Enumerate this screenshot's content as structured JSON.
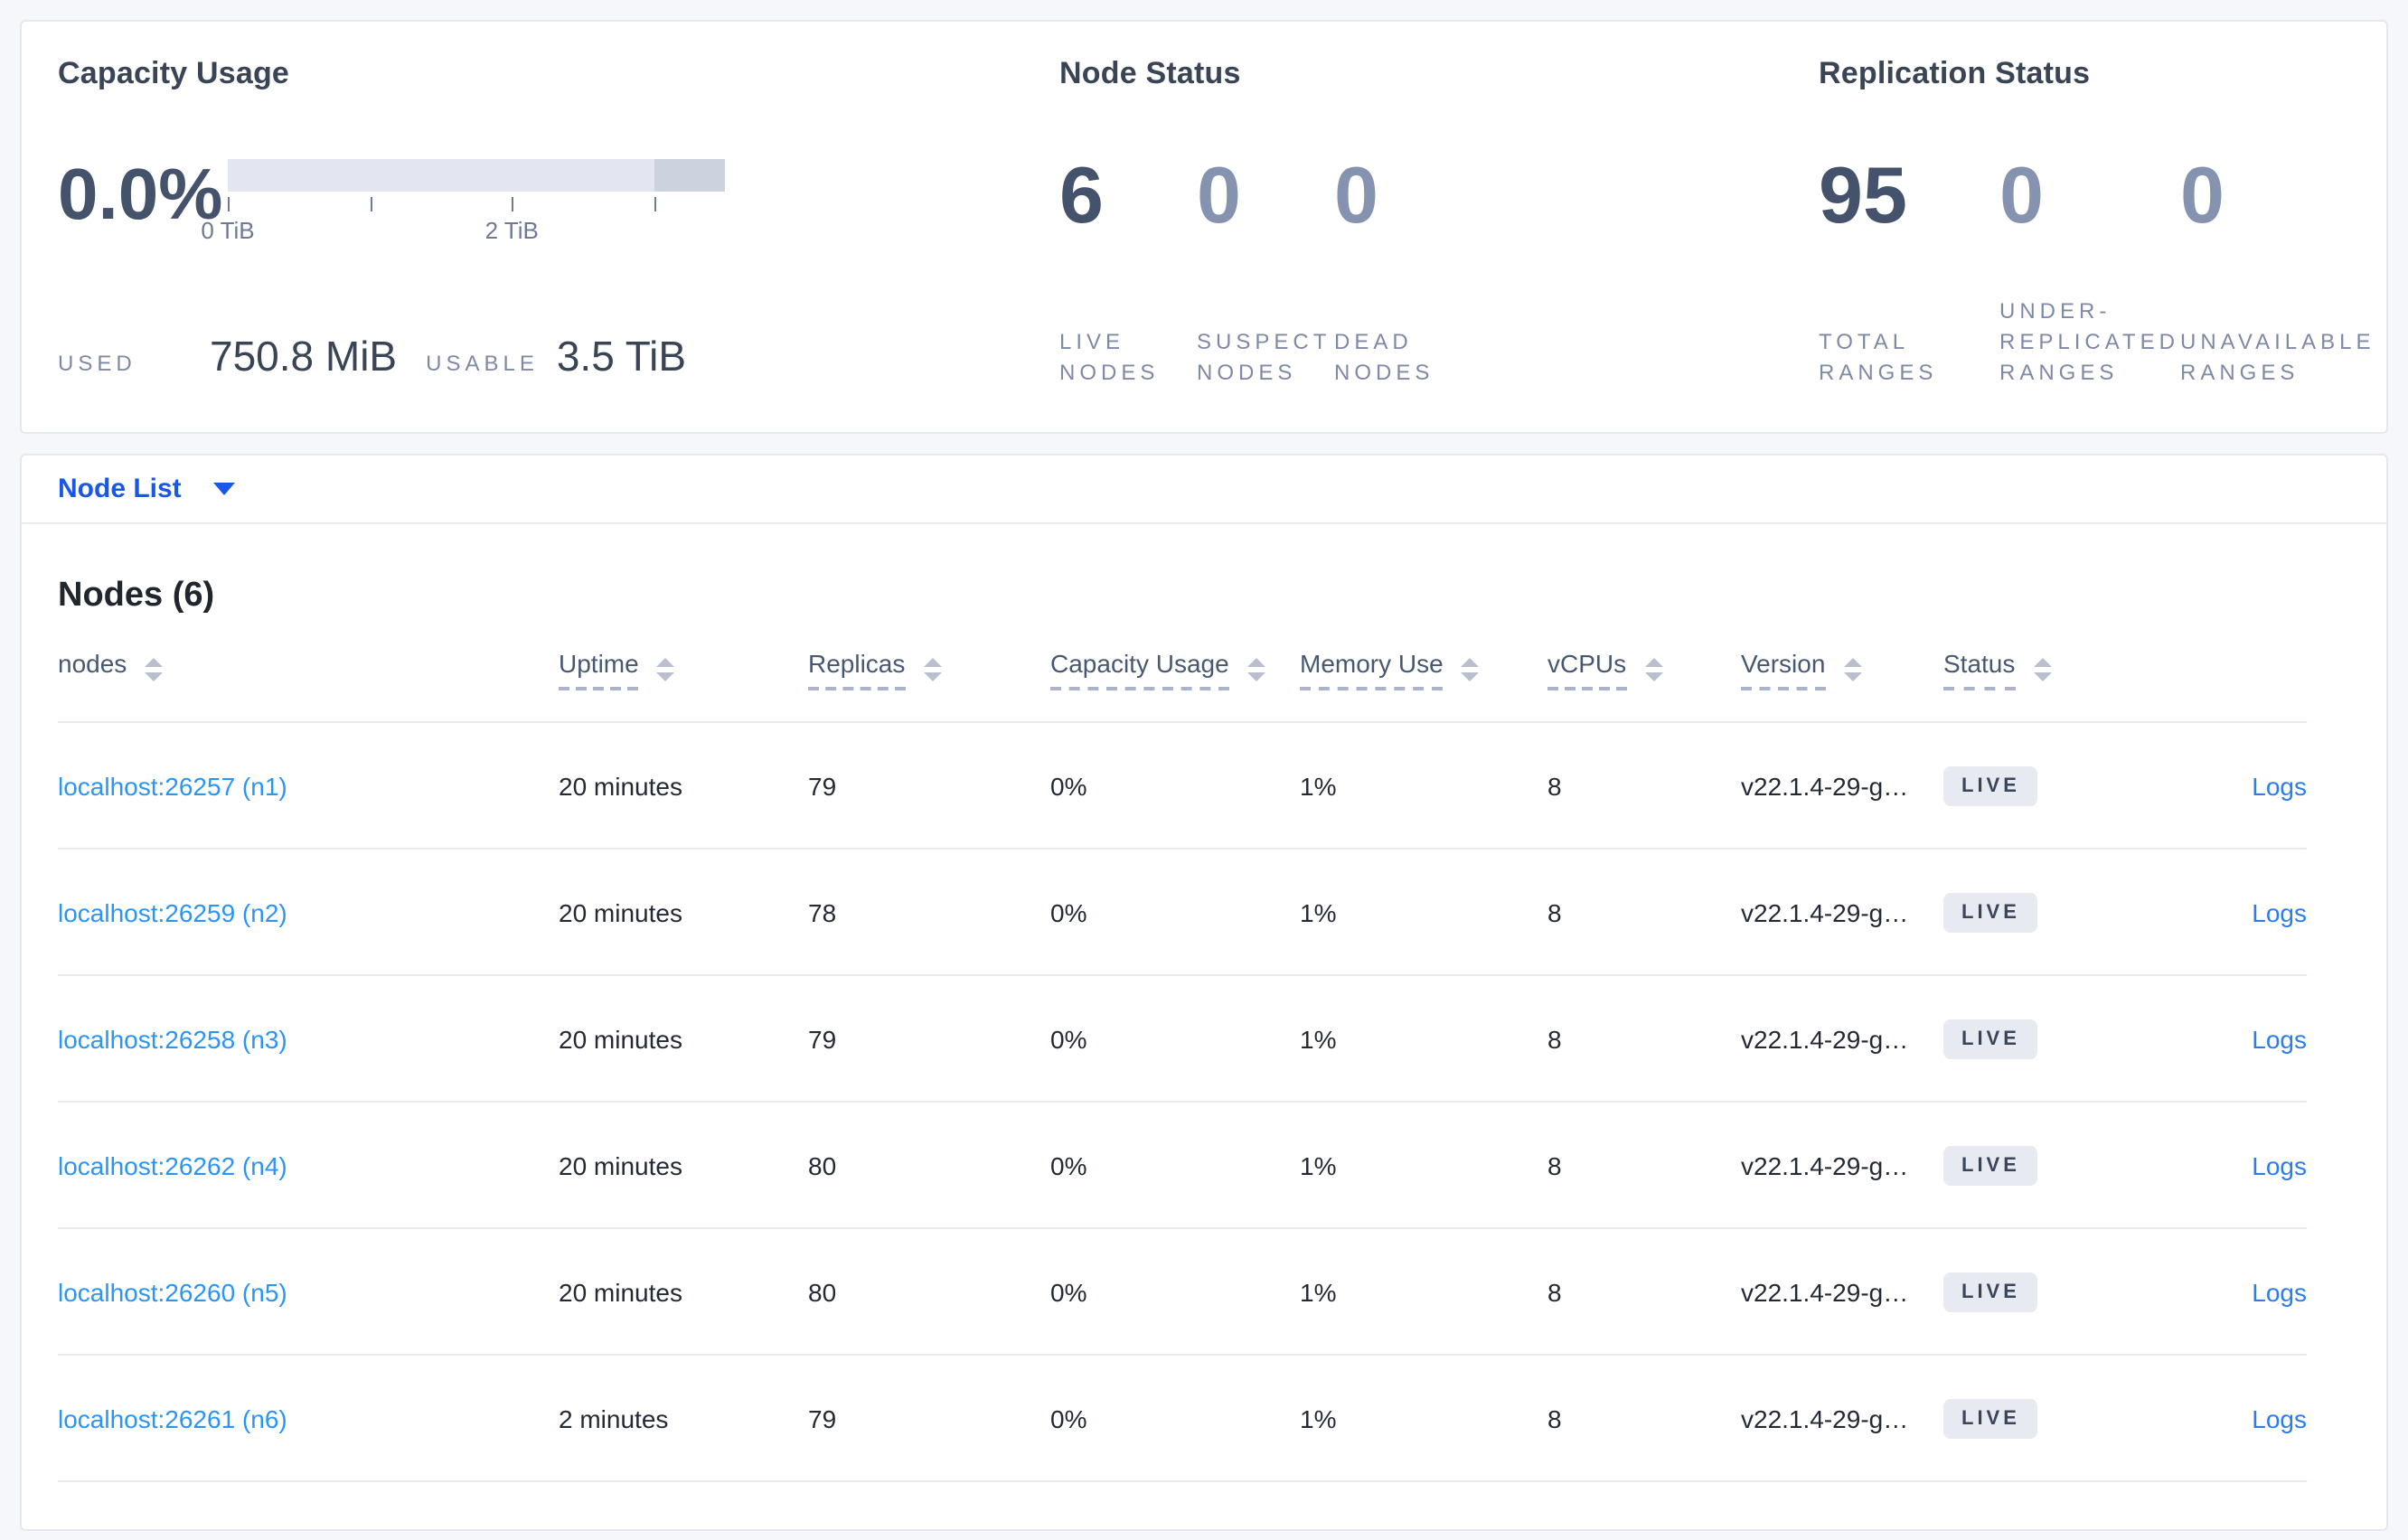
{
  "summary": {
    "capacity": {
      "title": "Capacity Usage",
      "percent": "0.0%",
      "ticks": [
        "0 TiB",
        "2 TiB"
      ],
      "used_label": "USED",
      "used_value": "750.8 MiB",
      "usable_label": "USABLE",
      "usable_value": "3.5 TiB",
      "bar_colors": {
        "track": "#e3e6f0",
        "tail_segment": "#cdd2df"
      }
    },
    "node_status": {
      "title": "Node Status",
      "stats": [
        {
          "value": "6",
          "lines": [
            "LIVE",
            "NODES"
          ]
        },
        {
          "value": "0",
          "lines": [
            "SUSPECT",
            "NODES"
          ]
        },
        {
          "value": "0",
          "lines": [
            "DEAD",
            "NODES"
          ]
        }
      ]
    },
    "replication": {
      "title": "Replication Status",
      "stats": [
        {
          "value": "95",
          "lines": [
            "TOTAL",
            "RANGES"
          ]
        },
        {
          "value": "0",
          "lines": [
            "UNDER-",
            "REPLICATED",
            "RANGES"
          ]
        },
        {
          "value": "0",
          "lines": [
            "UNAVAILABLE",
            "RANGES"
          ]
        }
      ]
    }
  },
  "node_list": {
    "selector_label": "Node List",
    "heading": "Nodes (6)"
  },
  "table": {
    "columns": [
      "nodes",
      "Uptime",
      "Replicas",
      "Capacity Usage",
      "Memory Use",
      "vCPUs",
      "Version",
      "Status"
    ],
    "logs_label": "Logs",
    "rows": [
      {
        "node": "localhost:26257 (n1)",
        "uptime": "20 minutes",
        "replicas": "79",
        "capacity": "0%",
        "memory": "1%",
        "vcpus": "8",
        "version": "v22.1.4-29-g…",
        "status": "LIVE"
      },
      {
        "node": "localhost:26259 (n2)",
        "uptime": "20 minutes",
        "replicas": "78",
        "capacity": "0%",
        "memory": "1%",
        "vcpus": "8",
        "version": "v22.1.4-29-g…",
        "status": "LIVE"
      },
      {
        "node": "localhost:26258 (n3)",
        "uptime": "20 minutes",
        "replicas": "79",
        "capacity": "0%",
        "memory": "1%",
        "vcpus": "8",
        "version": "v22.1.4-29-g…",
        "status": "LIVE"
      },
      {
        "node": "localhost:26262 (n4)",
        "uptime": "20 minutes",
        "replicas": "80",
        "capacity": "0%",
        "memory": "1%",
        "vcpus": "8",
        "version": "v22.1.4-29-g…",
        "status": "LIVE"
      },
      {
        "node": "localhost:26260 (n5)",
        "uptime": "20 minutes",
        "replicas": "80",
        "capacity": "0%",
        "memory": "1%",
        "vcpus": "8",
        "version": "v22.1.4-29-g…",
        "status": "LIVE"
      },
      {
        "node": "localhost:26261 (n6)",
        "uptime": "2 minutes",
        "replicas": "79",
        "capacity": "0%",
        "memory": "1%",
        "vcpus": "8",
        "version": "v22.1.4-29-g…",
        "status": "LIVE"
      }
    ],
    "colors": {
      "node_link": "#2a95f5",
      "logs_link": "#2d7de8",
      "selector_blue": "#1957eb"
    }
  }
}
